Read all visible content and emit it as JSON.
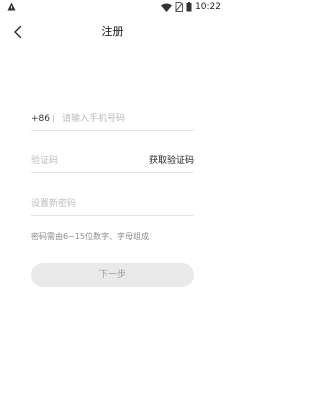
{
  "status_bar": {
    "time": "10:22"
  },
  "header": {
    "title": "注册"
  },
  "form": {
    "country_code": "+86",
    "phone_placeholder": "请输入手机号码",
    "code_placeholder": "验证码",
    "get_code_label": "获取验证码",
    "password_placeholder": "设置新密码",
    "password_hint": "密码需由6~15位数字、字母组成",
    "next_label": "下一步"
  },
  "icons": {
    "back": "chevron-left-icon",
    "status_left": "app-notification-icon",
    "wifi": "wifi-icon",
    "sim": "no-sim-icon",
    "battery": "battery-icon"
  },
  "colors": {
    "button_bg": "#e9e9e9",
    "button_text": "#9a9a9a",
    "divider": "#e5e5e5",
    "placeholder": "#bbbbbb",
    "hint": "#8a8a8a"
  }
}
